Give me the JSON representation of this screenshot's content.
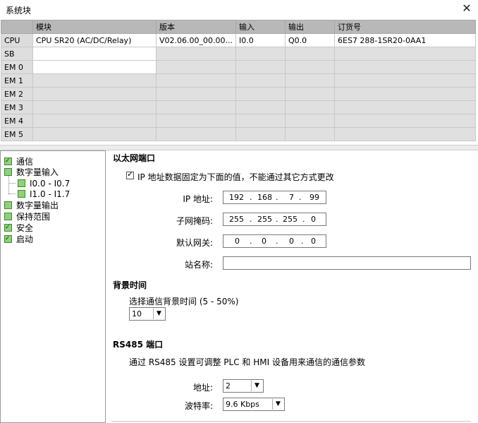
{
  "window": {
    "title": "系统块",
    "close": "✕"
  },
  "table": {
    "headers": [
      "模块",
      "版本",
      "输入",
      "输出",
      "订货号"
    ],
    "rows": [
      {
        "label": "CPU",
        "module": "CPU SR20 (AC/DC/Relay)",
        "version": "V02.06.00_00.00...",
        "input": "I0.0",
        "output": "Q0.0",
        "order": "6ES7 288-1SR20-0AA1"
      },
      {
        "label": "SB",
        "module": "",
        "version": "",
        "input": "",
        "output": "",
        "order": ""
      },
      {
        "label": "EM 0",
        "module": "",
        "version": "",
        "input": "",
        "output": "",
        "order": ""
      },
      {
        "label": "EM 1",
        "module": "",
        "version": "",
        "input": "",
        "output": "",
        "order": ""
      },
      {
        "label": "EM 2",
        "module": "",
        "version": "",
        "input": "",
        "output": "",
        "order": ""
      },
      {
        "label": "EM 3",
        "module": "",
        "version": "",
        "input": "",
        "output": "",
        "order": ""
      },
      {
        "label": "EM 4",
        "module": "",
        "version": "",
        "input": "",
        "output": "",
        "order": ""
      },
      {
        "label": "EM 5",
        "module": "",
        "version": "",
        "input": "",
        "output": "",
        "order": ""
      }
    ]
  },
  "tree": {
    "comm": "通信",
    "digital_in": "数字量输入",
    "range1": "I0.0 - I0.7",
    "range2": "I1.0 - I1.7",
    "digital_out": "数字量输出",
    "retain": "保持范围",
    "security": "安全",
    "startup": "启动"
  },
  "ethernet": {
    "heading": "以太网端口",
    "fixed_ip_label": "IP 地址数据固定为下面的值，不能通过其它方式更改",
    "ip_label": "IP 地址:",
    "ip": [
      "192",
      "168",
      "7",
      "99"
    ],
    "mask_label": "子网掩码:",
    "mask": [
      "255",
      "255",
      "255",
      "0"
    ],
    "gateway_label": "默认网关:",
    "gateway": [
      "0",
      "0",
      "0",
      "0"
    ],
    "station_label": "站名称:",
    "station_value": ""
  },
  "background": {
    "heading": "背景时间",
    "select_label": "选择通信背景时间 (5 - 50%)",
    "value": "10"
  },
  "rs485": {
    "heading": "RS485 端口",
    "desc": "通过 RS485 设置可调整 PLC 和 HMI 设备用来通信的通信参数",
    "address_label": "地址:",
    "address_value": "2",
    "baud_label": "波特率:",
    "baud_value": "9.6 Kbps"
  }
}
